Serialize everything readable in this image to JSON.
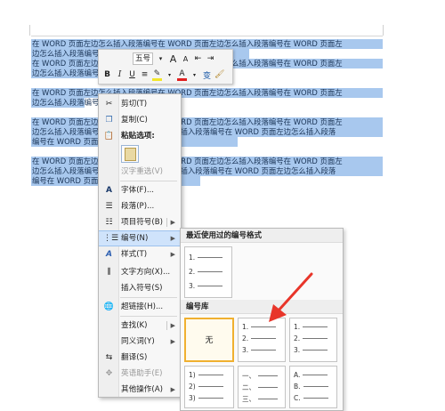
{
  "document": {
    "paragraph_lines": [
      "在 WORD 页面左边怎么插入段落编号在 WORD 页面左边怎么插入段落编号在 WORD 页面左",
      "边怎么插入段落编号",
      "在 WORD 页面左边怎么插入段落编号在 WORD 页面左边怎么插入段落编号在 WORD 页面左",
      "边怎么插入段落编号",
      "在 WORD 页面左边怎么插入段落编号在 WORD 页面左边怎么插入段落编号在 WORD 页面左",
      "边怎么插入段落编号",
      "在 WORD 页面左边怎么插入段落编号在 WORD 页面左边怎么插入段落编号在 WORD 页面左",
      "边怎么插入段落编号在 WORD 页面左边怎么插入段落编号在 WORD 页面左边怎么插入段落",
      "编号在 WORD 页面左边怎么插入段落编号",
      "在 WORD 页面左边怎么插入段落编号在 WORD 页面左边怎么插入段落编号在 WORD 页面左",
      "边怎么插入段落编号在 WORD 页面左边怎么插入段落编号在 WORD 页面左边怎么插入段落",
      "编号在 WORD 页面左边怎么插入段落编号"
    ],
    "highlight_color": "#a8c8ee"
  },
  "mini_toolbar": {
    "font_size": "五号",
    "grow_font": "A",
    "shrink_font": "A",
    "bold": "B",
    "italic": "I",
    "underline": "U",
    "font_color_letter": "A",
    "phonetic": "变"
  },
  "context_menu": {
    "items": {
      "cut": "剪切(T)",
      "copy": "复制(C)",
      "paste_options": "粘贴选项:",
      "chinese_reconvert": "汉字重选(V)",
      "font": "字体(F)...",
      "paragraph": "段落(P)...",
      "bullets": "项目符号(B)",
      "numbering": "编号(N)",
      "styles": "样式(T)",
      "text_direction": "文字方向(X)...",
      "insert_symbol": "插入符号(S)",
      "hyperlink": "超链接(H)...",
      "lookup": "查找(K)",
      "synonyms": "同义词(Y)",
      "translate": "翻译(S)",
      "english_assistant": "英语助手(E)",
      "other_actions": "其他操作(A)"
    }
  },
  "numbering_submenu": {
    "recent_header": "最近使用过的编号格式",
    "library_header": "编号库",
    "none_label": "无",
    "formats": {
      "arabic_dot": [
        "1.",
        "2.",
        "3."
      ],
      "paren": [
        "1)",
        "2)",
        "3)"
      ],
      "chinese": [
        "一、",
        "二、",
        "三、"
      ],
      "alpha": [
        "A.",
        "B.",
        "C."
      ]
    },
    "selected_border_color": "#f0b030"
  },
  "annotation": {
    "arrow_color": "#e8352a"
  }
}
